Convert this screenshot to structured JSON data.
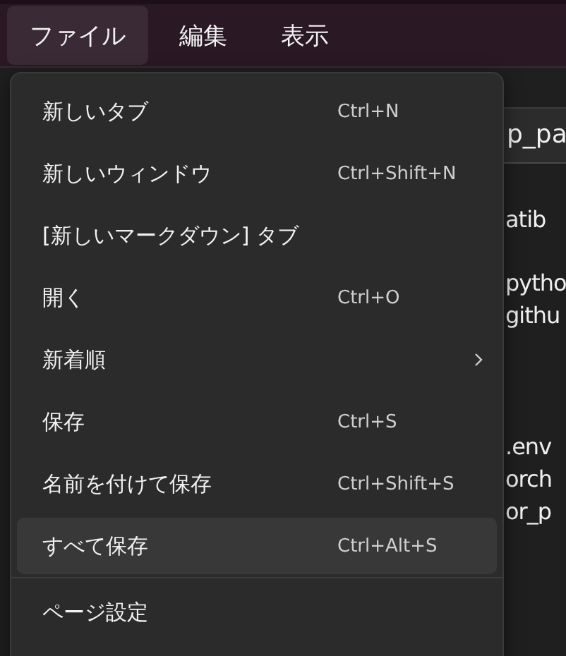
{
  "menubar": [
    {
      "label": "ファイル",
      "selected": true
    },
    {
      "label": "編集",
      "selected": false
    },
    {
      "label": "表示",
      "selected": false
    }
  ],
  "editor": {
    "field_value": "p_pa",
    "lines": [
      "atib",
      "pytho",
      "githu",
      ".env",
      "orch",
      "or_p"
    ]
  },
  "menu": {
    "items": [
      {
        "label": "新しいタブ",
        "shortcut": "Ctrl+N",
        "selected": false
      },
      {
        "label": "新しいウィンドウ",
        "shortcut": "Ctrl+Shift+N",
        "selected": false
      },
      {
        "label": "[新しいマークダウン] タブ",
        "selected": false
      },
      {
        "label": "開く",
        "shortcut": "Ctrl+O",
        "selected": false
      },
      {
        "label": "新着順",
        "submenu": true,
        "selected": false
      },
      {
        "label": "保存",
        "shortcut": "Ctrl+S",
        "selected": false
      },
      {
        "label": "名前を付けて保存",
        "shortcut": "Ctrl+Shift+S",
        "selected": false
      },
      {
        "label": "すべて保存",
        "shortcut": "Ctrl+Alt+S",
        "selected": true
      },
      {
        "label": "ページ設定",
        "divider_before": true,
        "selected": false
      }
    ]
  }
}
